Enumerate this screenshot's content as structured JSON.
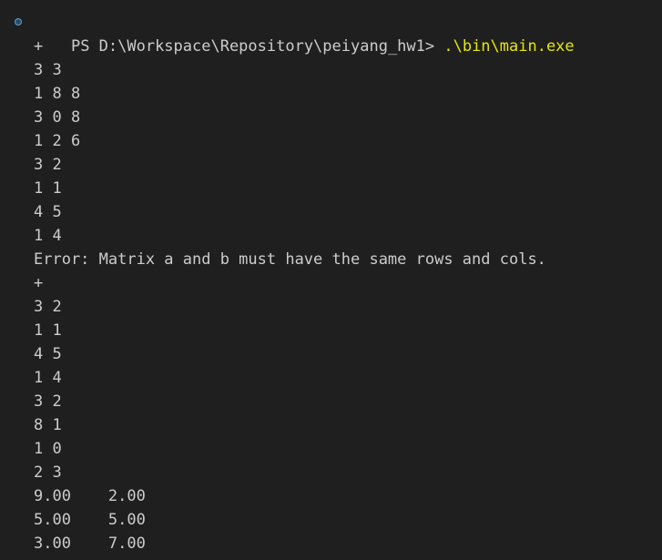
{
  "terminal": {
    "prompt": "PS D:\\Workspace\\Repository\\peiyang_hw1> ",
    "command": ".\\bin\\main.exe",
    "output": [
      "+",
      "3 3",
      "1 8 8",
      "3 0 8",
      "1 2 6",
      "3 2",
      "1 1",
      "4 5",
      "1 4",
      "Error: Matrix a and b must have the same rows and cols.",
      "+",
      "3 2",
      "1 1",
      "4 5",
      "1 4",
      "3 2",
      "8 1",
      "1 0",
      "2 3",
      "9.00    2.00",
      "5.00    5.00",
      "3.00    7.00"
    ]
  },
  "colors": {
    "background": "#1f1f1f",
    "text": "#cccccc",
    "command": "#e5e510",
    "status_dot": "#5f9fd6"
  }
}
